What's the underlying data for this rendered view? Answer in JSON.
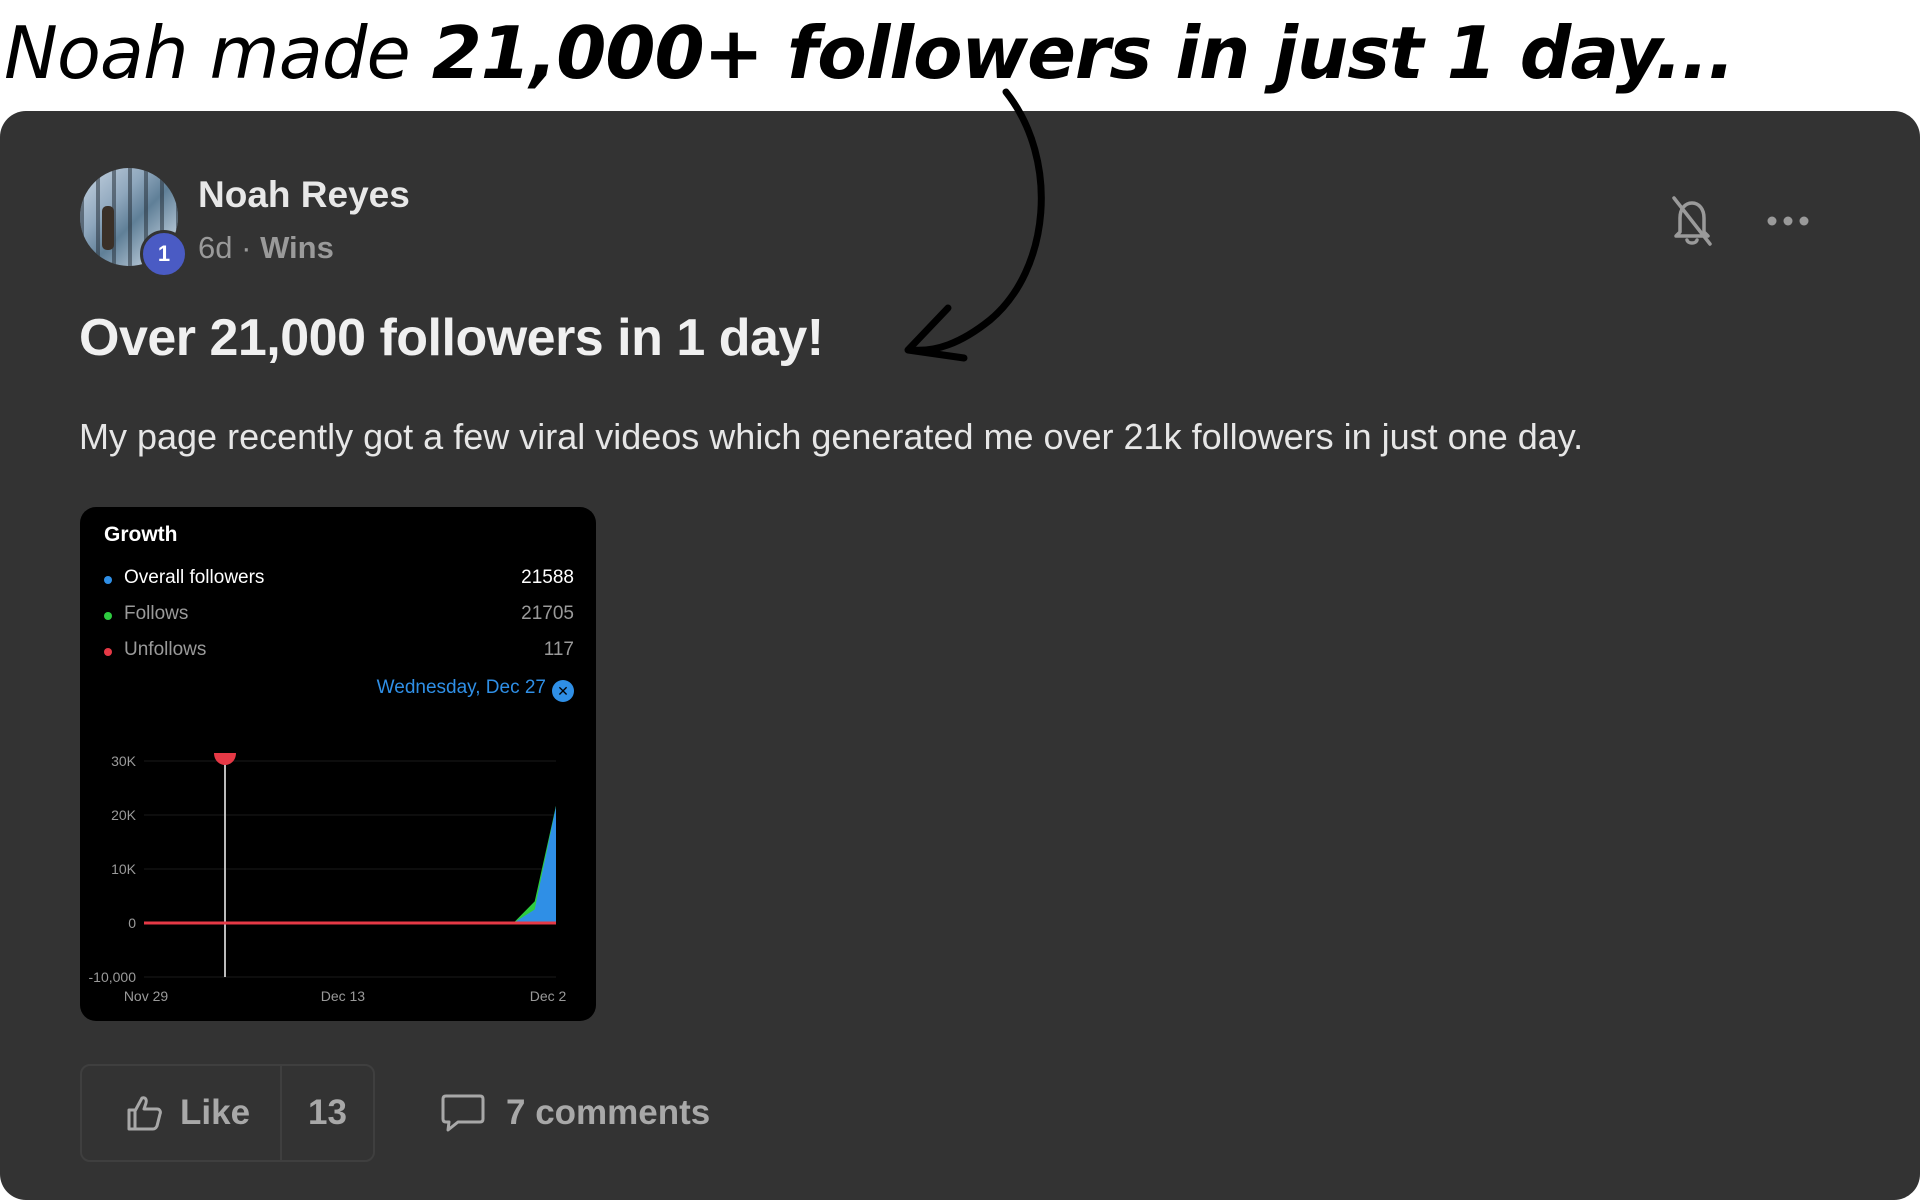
{
  "annotation": {
    "lead": "Noah made ",
    "emphasis": "21,000+ followers in just 1 day..."
  },
  "post": {
    "author": "Noah Reyes",
    "level": "1",
    "age": "6d",
    "separator": "·",
    "category": "Wins",
    "title": "Over 21,000 followers in 1 day!",
    "body": "My page recently got a few viral videos which generated me over 21k followers in just one day."
  },
  "actions": {
    "like_label": "Like",
    "like_count": "13",
    "comments_label": "7 comments"
  },
  "icons": {
    "bell": "bell-off-icon",
    "more": "more-horizontal-icon",
    "like": "thumbs-up-icon",
    "comment": "comment-bubble-icon",
    "close": "close-circle-icon"
  },
  "colors": {
    "card_bg": "#333333",
    "badge": "#4a5bc4",
    "overall": "#2f8fe6",
    "follows": "#2ecc40",
    "unfollows": "#e63946",
    "date_tag": "#2f8fe6"
  },
  "chart_data": {
    "type": "area",
    "title": "Growth",
    "legend": [
      {
        "name": "Overall followers",
        "value": "21588",
        "color": "#2f8fe6"
      },
      {
        "name": "Follows",
        "value": "21705",
        "color": "#2ecc40"
      },
      {
        "name": "Unfollows",
        "value": "117",
        "color": "#e63946"
      }
    ],
    "selected_date": "Wednesday, Dec 27",
    "y_ticks": [
      "30K",
      "20K",
      "10K",
      "0",
      "-10,000"
    ],
    "ylim": [
      -10000,
      30000
    ],
    "x_ticks": [
      "Nov 29",
      "Dec 13",
      "Dec 2"
    ],
    "x_days": 29,
    "series": [
      {
        "name": "Follows",
        "points": [
          [
            0,
            0
          ],
          [
            26,
            0
          ],
          [
            27.5,
            4000
          ],
          [
            29,
            21705
          ]
        ]
      },
      {
        "name": "Overall followers",
        "points": [
          [
            0,
            0
          ],
          [
            26,
            0
          ],
          [
            27.5,
            2500
          ],
          [
            29,
            21588
          ]
        ]
      },
      {
        "name": "Unfollows",
        "points": [
          [
            0,
            0
          ],
          [
            29,
            0
          ]
        ]
      }
    ]
  }
}
